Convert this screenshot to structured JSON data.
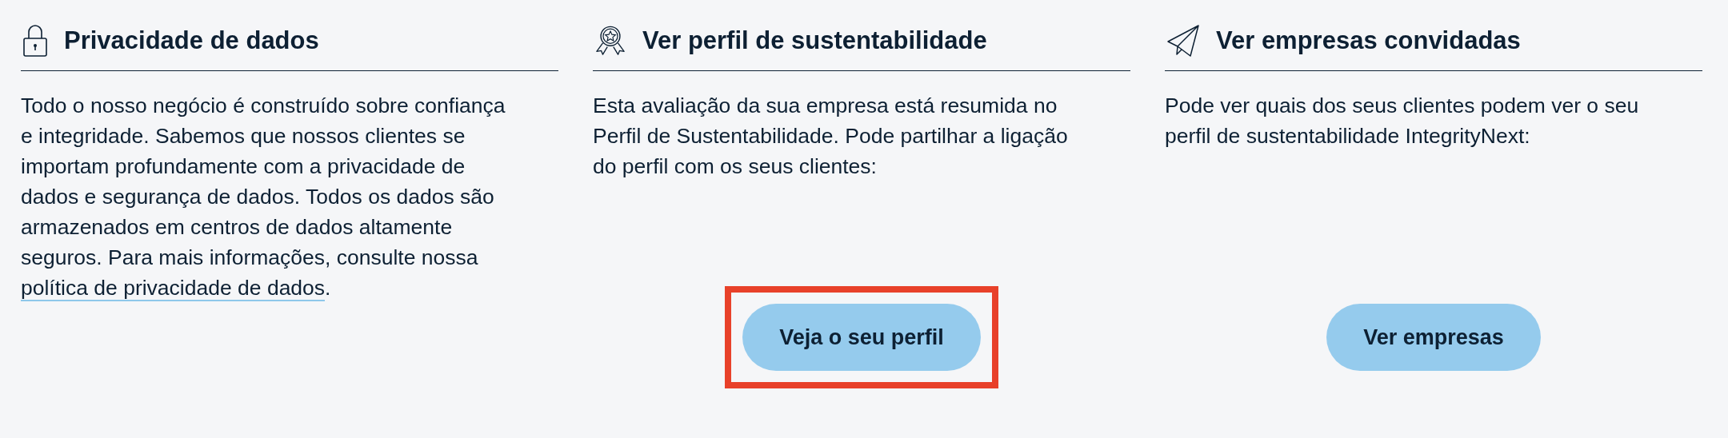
{
  "cards": [
    {
      "title": "Privacidade de dados",
      "text": "Todo o nosso negócio é construído sobre confiança e integridade. Sabemos que nossos clientes se importam profundamente com a privacidade de dados e segurança de dados. Todos os dados são armazenados em centros de dados altamente seguros. Para mais informações, consulte nossa",
      "link": "política de privacidade de dados",
      "text_after": "."
    },
    {
      "title": "Ver perfil de sustentabilidade",
      "text": "Esta avaliação da sua empresa está resumida no Perfil de Sustentabilidade. Pode partilhar a ligação do perfil com os seus clientes:",
      "button": {
        "label": "Veja o seu perfil",
        "highlighted": true
      }
    },
    {
      "title": "Ver empresas convidadas",
      "text": "Pode ver quais dos seus clientes podem ver o seu perfil de sustentabilidade IntegrityNext:",
      "button": {
        "label": "Ver empresas",
        "highlighted": false
      }
    }
  ]
}
